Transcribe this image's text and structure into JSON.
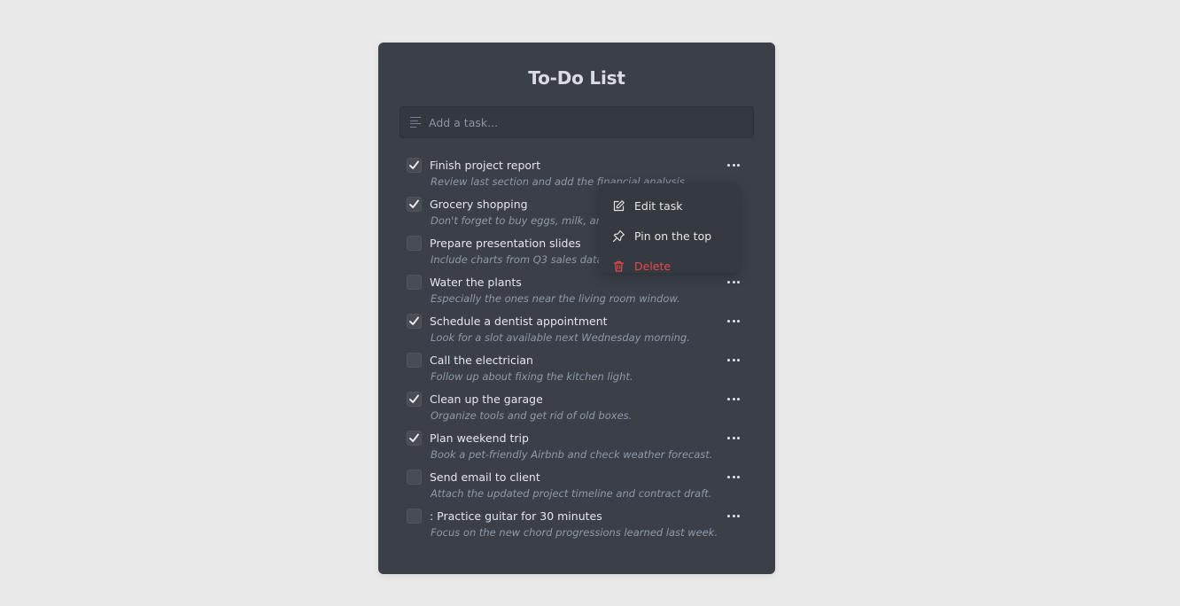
{
  "app": {
    "title": "To-Do List"
  },
  "input": {
    "placeholder": "Add a task..."
  },
  "tasks": [
    {
      "title": "Finish project report",
      "description": "Review last section and add the financial analysis.",
      "checked": true
    },
    {
      "title": "Grocery shopping",
      "description": "Don't forget to buy eggs, milk, and coffee.",
      "checked": true
    },
    {
      "title": "Prepare presentation slides",
      "description": "Include charts from Q3 sales data on slides.",
      "checked": false
    },
    {
      "title": "Water the plants",
      "description": "Especially the ones near the living room window.",
      "checked": false
    },
    {
      "title": "Schedule a dentist appointment",
      "description": "Look for a slot available next Wednesday morning.",
      "checked": true
    },
    {
      "title": "Call the electrician",
      "description": "Follow up about fixing the kitchen light.",
      "checked": false
    },
    {
      "title": "Clean up the garage",
      "description": "Organize tools and get rid of old boxes.",
      "checked": true
    },
    {
      "title": "Plan weekend trip",
      "description": "Book a pet-friendly Airbnb and check weather forecast.",
      "checked": true
    },
    {
      "title": "Send email to client",
      "description": "Attach the updated project timeline and contract draft.",
      "checked": false
    },
    {
      "title": ": Practice guitar for 30 minutes",
      "description": "Focus on the new chord progressions learned last week.",
      "checked": false
    }
  ],
  "context_menu": {
    "edit_label": "Edit task",
    "pin_label": "Pin on the top",
    "delete_label": "Delete"
  },
  "colors": {
    "background": "#e9e9e9",
    "card": "#3b4048",
    "danger": "#e84a4a"
  },
  "icons": {
    "input": "text-lines-icon",
    "check": "checkmark-icon",
    "more": "more-dots-icon",
    "edit": "edit-icon",
    "pin": "pin-icon",
    "delete": "trash-icon"
  }
}
